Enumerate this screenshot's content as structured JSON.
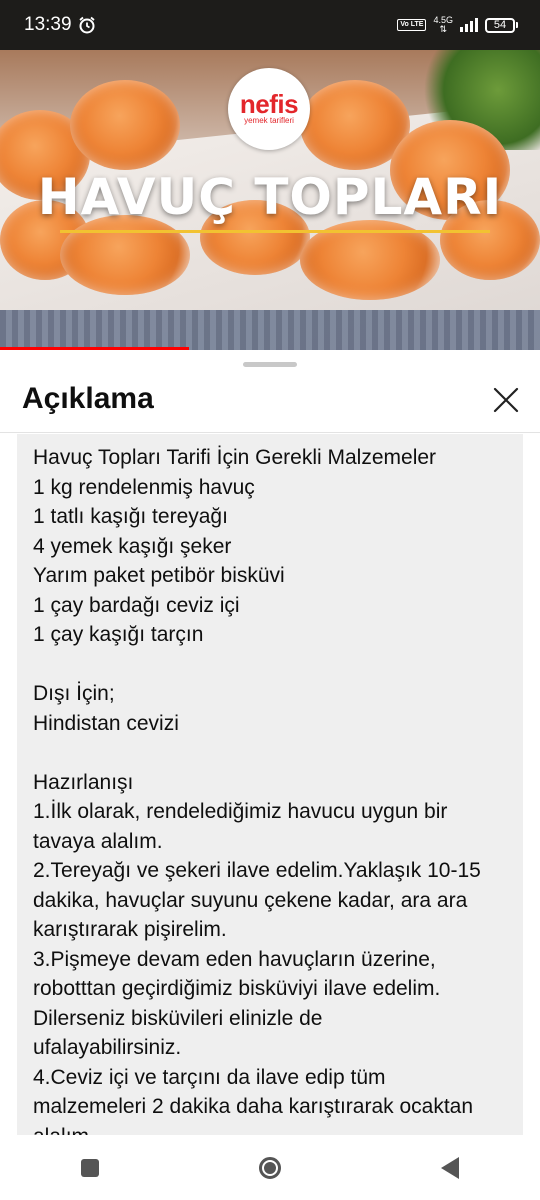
{
  "status_bar": {
    "time": "13:39",
    "alarm_icon": "alarm-clock-icon",
    "volte": "Vo LTE",
    "network": "4.5G",
    "battery": "54"
  },
  "video": {
    "brand_main": "nefis",
    "brand_sub": "yemek tarifleri",
    "title_overlay": "HAVUÇ TOPLARI",
    "progress_fraction": 0.35
  },
  "sheet": {
    "title": "Açıklama",
    "close_icon": "close-icon",
    "description_lines": [
      "Havuç Topları Tarifi İçin Gerekli Malzemeler",
      "1 kg rendelenmiş havuç",
      "1 tatlı kaşığı tereyağı",
      "4 yemek kaşığı şeker",
      "Yarım paket petibör bisküvi",
      "1 çay bardağı ceviz içi",
      "1 çay kaşığı tarçın",
      "",
      "Dışı İçin;",
      "Hindistan cevizi",
      "",
      "Hazırlanışı",
      "1.İlk olarak, rendelediğimiz havucu uygun bir",
      "tavaya alalım.",
      "2.Tereyağı ve şekeri ilave edelim.Yaklaşık 10-15",
      "dakika, havuçlar suyunu çekene kadar, ara ara",
      "karıştırarak pişirelim.",
      "3.Pişmeye devam eden havuçların üzerine,",
      "robotttan geçirdiğimiz bisküviyi ilave edelim.",
      "Dilerseniz bisküvileri elinizle de",
      "ufalayabilirsiniz.",
      "4.Ceviz içi ve tarçını da ilave edip tüm",
      "malzemeleri 2 dakika daha karıştırarak ocaktan",
      "alalım."
    ]
  },
  "nav_bar": {
    "recents_icon": "recents-square-icon",
    "home_icon": "home-circle-icon",
    "back_icon": "back-triangle-icon"
  }
}
